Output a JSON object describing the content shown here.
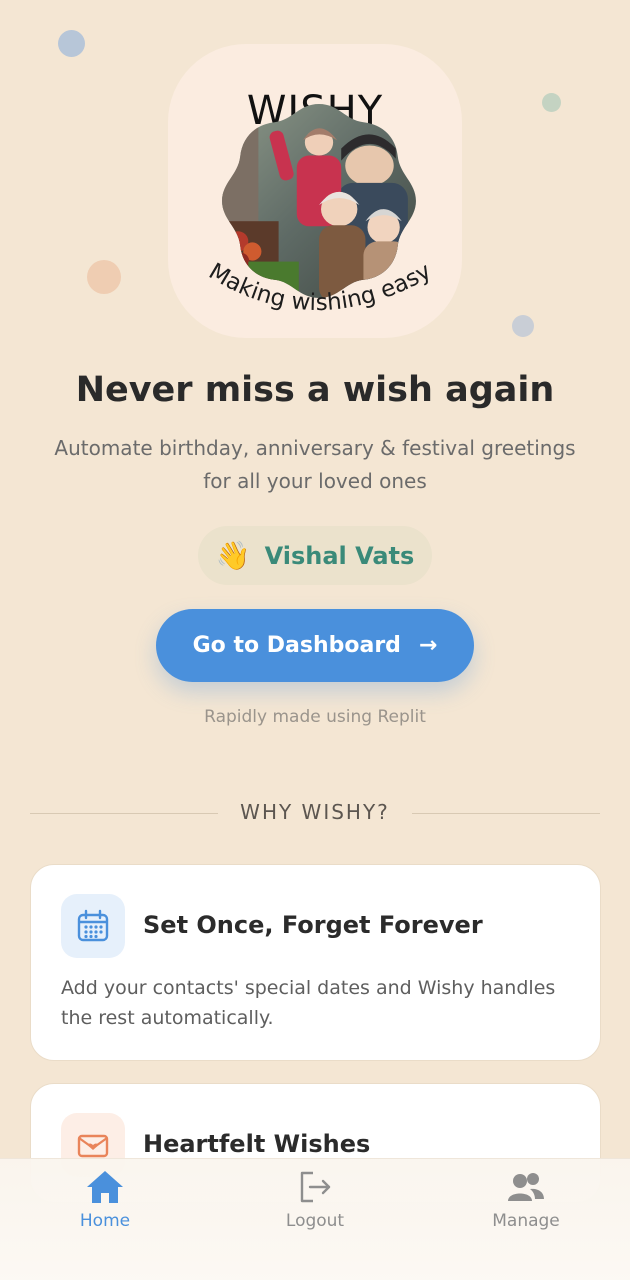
{
  "app": {
    "logo_title": "WISHY",
    "logo_tagline": "Making wishing easy",
    "photo_alt": "Family photo in a wavy frame"
  },
  "hero": {
    "headline": "Never miss a wish again",
    "subhead": "Automate birthday, anniversary & festival greetings for all your loved ones"
  },
  "user": {
    "wave": "👋",
    "name": "Vishal Vats"
  },
  "cta": {
    "label": "Go to Dashboard",
    "arrow": "→"
  },
  "credit": "Rapidly made using Replit",
  "section": {
    "label": "WHY WISHY?"
  },
  "features": [
    {
      "icon": "calendar-icon",
      "title": "Set Once, Forget Forever",
      "desc": "Add your contacts' special dates and Wishy handles the rest automatically."
    },
    {
      "icon": "envelope-heart-icon",
      "title": "Heartfelt Wishes"
    }
  ],
  "nav": [
    {
      "label": "Home",
      "icon": "home-icon",
      "active": true
    },
    {
      "label": "Logout",
      "icon": "logout-icon",
      "active": false
    },
    {
      "label": "Manage",
      "icon": "users-icon",
      "active": false
    }
  ],
  "colors": {
    "background": "#f4e6d3",
    "accent": "#4a90dc",
    "name": "#3a8a79",
    "card": "#ffffff"
  }
}
